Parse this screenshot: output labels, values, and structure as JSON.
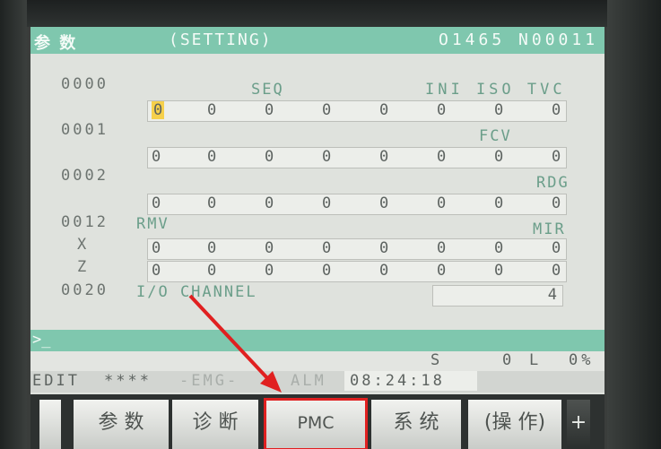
{
  "header": {
    "screen_name": "参 数",
    "mode": "(SETTING)",
    "program": "O1465 N00011"
  },
  "params": [
    {
      "no": "0000",
      "labels": [
        "SEQ",
        "INI ISO TVC"
      ],
      "rows": [
        [
          "0",
          "0",
          "0",
          "0",
          "0",
          "0",
          "0",
          "0"
        ]
      ]
    },
    {
      "no": "0001",
      "labels": [
        "FCV"
      ],
      "rows": [
        [
          "0",
          "0",
          "0",
          "0",
          "0",
          "0",
          "0",
          "0"
        ]
      ]
    },
    {
      "no": "0002",
      "labels": [
        "RDG"
      ],
      "rows": [
        [
          "0",
          "0",
          "0",
          "0",
          "0",
          "0",
          "0",
          "0"
        ]
      ]
    },
    {
      "no": "0012",
      "labels": [
        "RMV",
        "MIR"
      ],
      "axes": [
        "X",
        "Z"
      ],
      "rows": [
        [
          "0",
          "0",
          "0",
          "0",
          "0",
          "0",
          "0",
          "0"
        ],
        [
          "0",
          "0",
          "0",
          "0",
          "0",
          "0",
          "0",
          "0"
        ]
      ]
    },
    {
      "no": "0020",
      "labels": [
        "I/O CHANNEL"
      ],
      "value": "4"
    }
  ],
  "input_prompt": ">_",
  "status": {
    "line1": [
      "S",
      "0",
      "L",
      "0%"
    ],
    "mode": "EDIT",
    "stars": "****",
    "alarm": "-EMG-",
    "alm": "ALM",
    "time": "08:24:18"
  },
  "softkeys": [
    {
      "label": "参 数"
    },
    {
      "label": "诊 断"
    },
    {
      "label": "PMC"
    },
    {
      "label": "系 统"
    },
    {
      "label": "(操 作)"
    },
    {
      "label": "+"
    }
  ],
  "colors": {
    "accent": "#7fc7ae",
    "highlight": "#e02020",
    "cursor": "#f6d04b"
  }
}
